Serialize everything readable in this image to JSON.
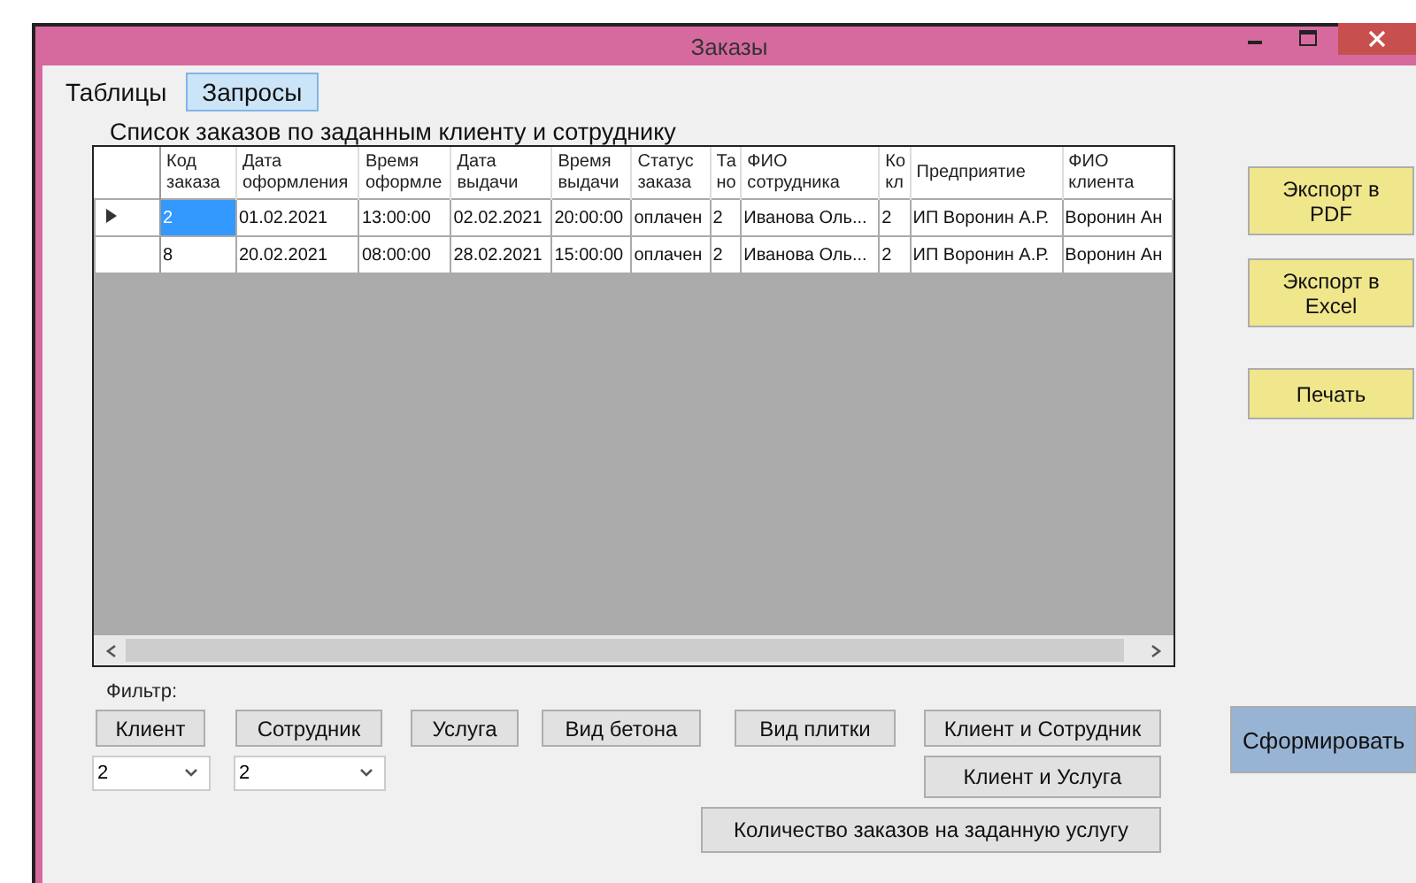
{
  "window": {
    "title": "Заказы"
  },
  "menu": [
    {
      "label": "Таблицы",
      "selected": false
    },
    {
      "label": "Запросы",
      "selected": true
    }
  ],
  "caption": "Список заказов по заданным клиенту и сотруднику",
  "table": {
    "columns": [
      "Код\nзаказа",
      "Дата\nоформления",
      "Время\nоформле",
      "Дата\nвыдачи",
      "Время\nвыдачи",
      "Статус\nзаказа",
      "Та\nно",
      "ФИО\nсотрудника",
      "Ко\nкл",
      "Предприятие",
      "ФИО\nклиента"
    ],
    "rows": [
      {
        "selected": true,
        "cells": [
          "2",
          "01.02.2021",
          "13:00:00",
          "02.02.2021",
          "20:00:00",
          "оплачен",
          "2",
          "Иванова Оль...",
          "2",
          "ИП Воронин А.Р.",
          "Воронин Ан"
        ]
      },
      {
        "selected": false,
        "cells": [
          "8",
          "20.02.2021",
          "08:00:00",
          "28.02.2021",
          "15:00:00",
          "оплачен",
          "2",
          "Иванова Оль...",
          "2",
          "ИП Воронин А.Р.",
          "Воронин Ан"
        ]
      }
    ]
  },
  "side_buttons": [
    "Экспорт в\nPDF",
    "Экспорт в\nExcel",
    "Печать"
  ],
  "filter_label": "Фильтр:",
  "filter_buttons": [
    "Клиент",
    "Сотрудник",
    "Услуга",
    "Вид бетона",
    "Вид плитки",
    "Клиент и Сотрудник"
  ],
  "dropdowns": [
    {
      "value": "2"
    },
    {
      "value": "2"
    }
  ],
  "client_service_button": "Клиент и Услуга",
  "count_button": "Количество заказов на заданную услугу",
  "submit_button": "Сформировать"
}
